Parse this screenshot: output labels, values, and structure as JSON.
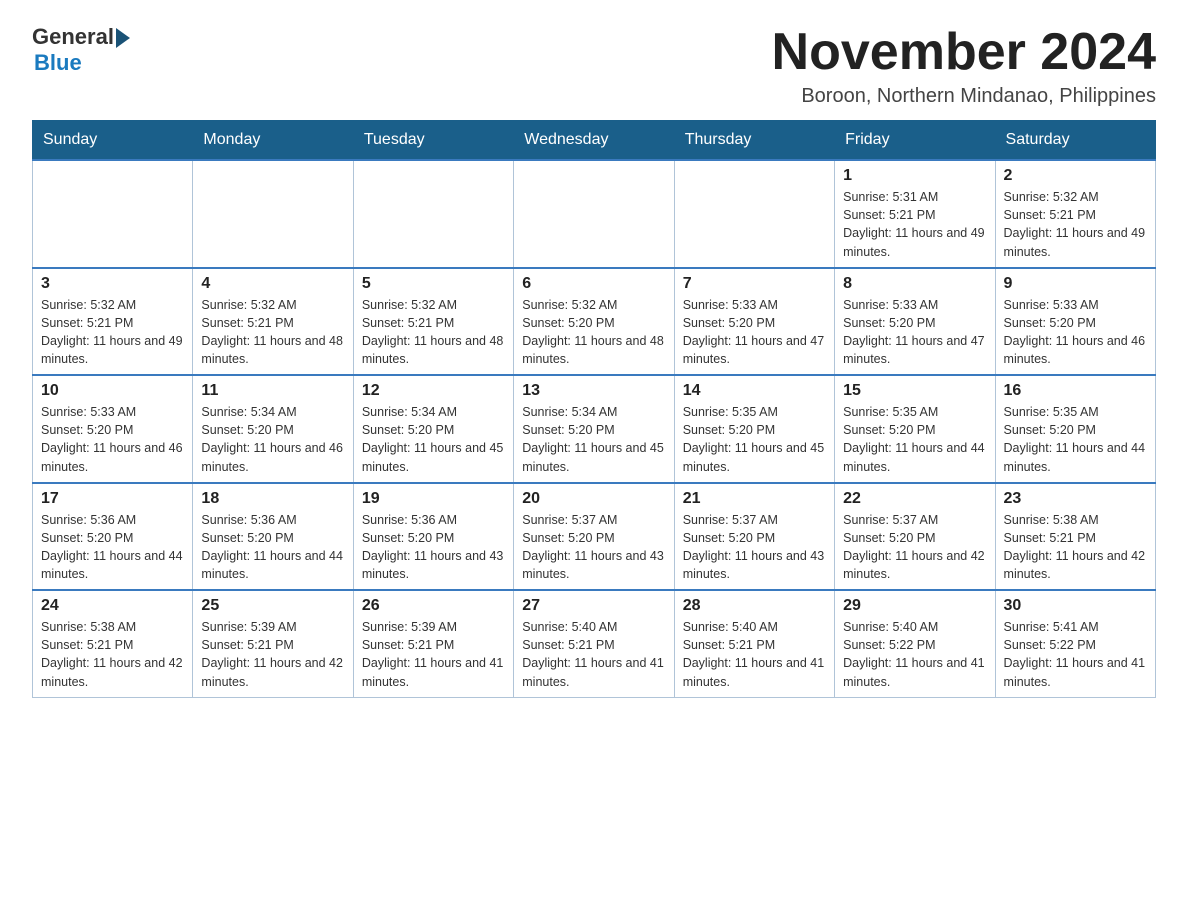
{
  "logo": {
    "general": "General",
    "blue": "Blue"
  },
  "header": {
    "month": "November 2024",
    "location": "Boroon, Northern Mindanao, Philippines"
  },
  "days_of_week": [
    "Sunday",
    "Monday",
    "Tuesday",
    "Wednesday",
    "Thursday",
    "Friday",
    "Saturday"
  ],
  "weeks": [
    [
      {
        "day": "",
        "info": ""
      },
      {
        "day": "",
        "info": ""
      },
      {
        "day": "",
        "info": ""
      },
      {
        "day": "",
        "info": ""
      },
      {
        "day": "",
        "info": ""
      },
      {
        "day": "1",
        "info": "Sunrise: 5:31 AM\nSunset: 5:21 PM\nDaylight: 11 hours and 49 minutes."
      },
      {
        "day": "2",
        "info": "Sunrise: 5:32 AM\nSunset: 5:21 PM\nDaylight: 11 hours and 49 minutes."
      }
    ],
    [
      {
        "day": "3",
        "info": "Sunrise: 5:32 AM\nSunset: 5:21 PM\nDaylight: 11 hours and 49 minutes."
      },
      {
        "day": "4",
        "info": "Sunrise: 5:32 AM\nSunset: 5:21 PM\nDaylight: 11 hours and 48 minutes."
      },
      {
        "day": "5",
        "info": "Sunrise: 5:32 AM\nSunset: 5:21 PM\nDaylight: 11 hours and 48 minutes."
      },
      {
        "day": "6",
        "info": "Sunrise: 5:32 AM\nSunset: 5:20 PM\nDaylight: 11 hours and 48 minutes."
      },
      {
        "day": "7",
        "info": "Sunrise: 5:33 AM\nSunset: 5:20 PM\nDaylight: 11 hours and 47 minutes."
      },
      {
        "day": "8",
        "info": "Sunrise: 5:33 AM\nSunset: 5:20 PM\nDaylight: 11 hours and 47 minutes."
      },
      {
        "day": "9",
        "info": "Sunrise: 5:33 AM\nSunset: 5:20 PM\nDaylight: 11 hours and 46 minutes."
      }
    ],
    [
      {
        "day": "10",
        "info": "Sunrise: 5:33 AM\nSunset: 5:20 PM\nDaylight: 11 hours and 46 minutes."
      },
      {
        "day": "11",
        "info": "Sunrise: 5:34 AM\nSunset: 5:20 PM\nDaylight: 11 hours and 46 minutes."
      },
      {
        "day": "12",
        "info": "Sunrise: 5:34 AM\nSunset: 5:20 PM\nDaylight: 11 hours and 45 minutes."
      },
      {
        "day": "13",
        "info": "Sunrise: 5:34 AM\nSunset: 5:20 PM\nDaylight: 11 hours and 45 minutes."
      },
      {
        "day": "14",
        "info": "Sunrise: 5:35 AM\nSunset: 5:20 PM\nDaylight: 11 hours and 45 minutes."
      },
      {
        "day": "15",
        "info": "Sunrise: 5:35 AM\nSunset: 5:20 PM\nDaylight: 11 hours and 44 minutes."
      },
      {
        "day": "16",
        "info": "Sunrise: 5:35 AM\nSunset: 5:20 PM\nDaylight: 11 hours and 44 minutes."
      }
    ],
    [
      {
        "day": "17",
        "info": "Sunrise: 5:36 AM\nSunset: 5:20 PM\nDaylight: 11 hours and 44 minutes."
      },
      {
        "day": "18",
        "info": "Sunrise: 5:36 AM\nSunset: 5:20 PM\nDaylight: 11 hours and 44 minutes."
      },
      {
        "day": "19",
        "info": "Sunrise: 5:36 AM\nSunset: 5:20 PM\nDaylight: 11 hours and 43 minutes."
      },
      {
        "day": "20",
        "info": "Sunrise: 5:37 AM\nSunset: 5:20 PM\nDaylight: 11 hours and 43 minutes."
      },
      {
        "day": "21",
        "info": "Sunrise: 5:37 AM\nSunset: 5:20 PM\nDaylight: 11 hours and 43 minutes."
      },
      {
        "day": "22",
        "info": "Sunrise: 5:37 AM\nSunset: 5:20 PM\nDaylight: 11 hours and 42 minutes."
      },
      {
        "day": "23",
        "info": "Sunrise: 5:38 AM\nSunset: 5:21 PM\nDaylight: 11 hours and 42 minutes."
      }
    ],
    [
      {
        "day": "24",
        "info": "Sunrise: 5:38 AM\nSunset: 5:21 PM\nDaylight: 11 hours and 42 minutes."
      },
      {
        "day": "25",
        "info": "Sunrise: 5:39 AM\nSunset: 5:21 PM\nDaylight: 11 hours and 42 minutes."
      },
      {
        "day": "26",
        "info": "Sunrise: 5:39 AM\nSunset: 5:21 PM\nDaylight: 11 hours and 41 minutes."
      },
      {
        "day": "27",
        "info": "Sunrise: 5:40 AM\nSunset: 5:21 PM\nDaylight: 11 hours and 41 minutes."
      },
      {
        "day": "28",
        "info": "Sunrise: 5:40 AM\nSunset: 5:21 PM\nDaylight: 11 hours and 41 minutes."
      },
      {
        "day": "29",
        "info": "Sunrise: 5:40 AM\nSunset: 5:22 PM\nDaylight: 11 hours and 41 minutes."
      },
      {
        "day": "30",
        "info": "Sunrise: 5:41 AM\nSunset: 5:22 PM\nDaylight: 11 hours and 41 minutes."
      }
    ]
  ]
}
